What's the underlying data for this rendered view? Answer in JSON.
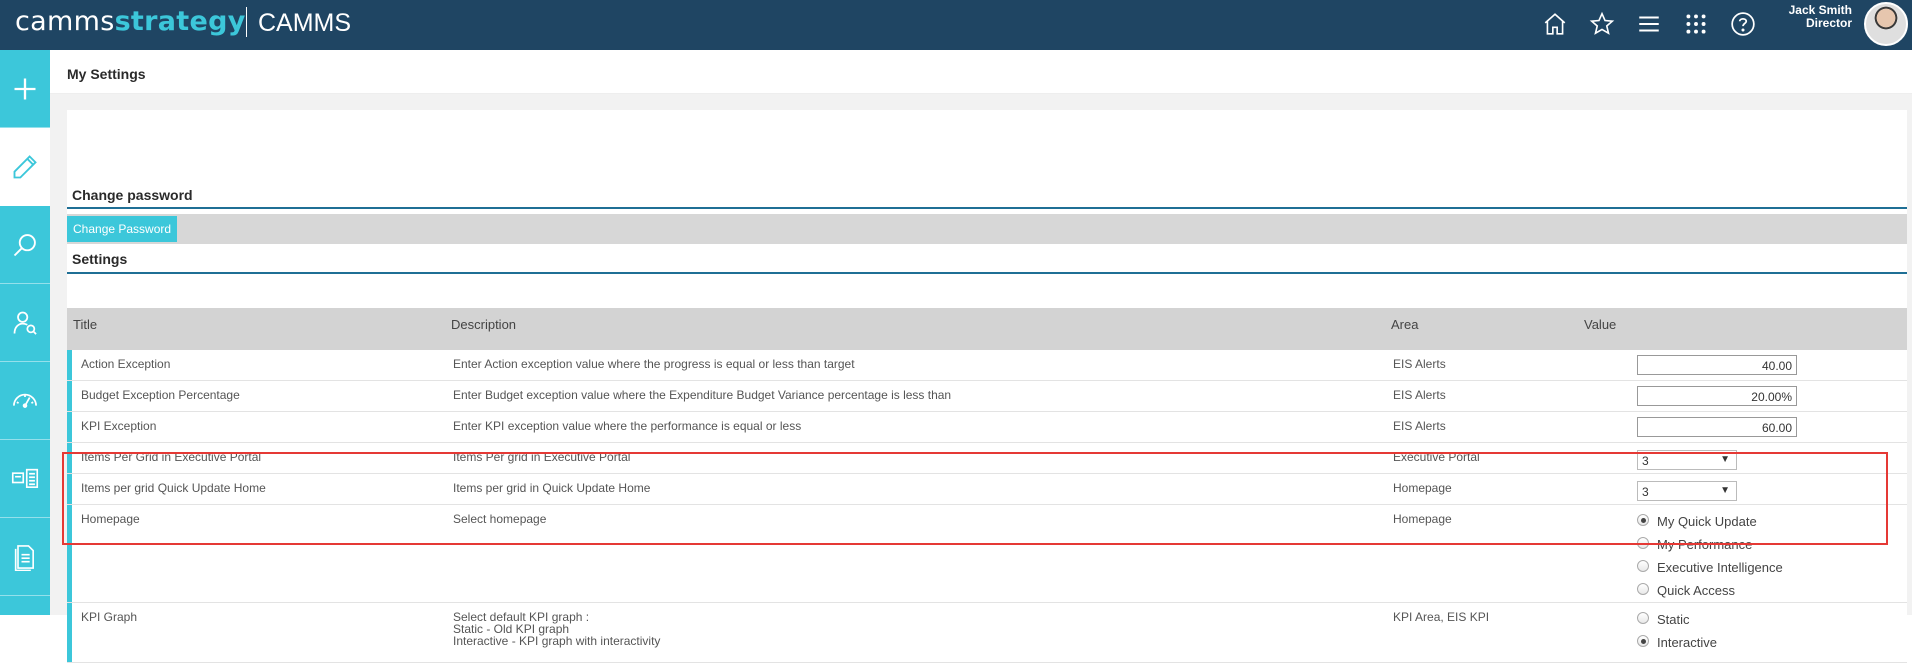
{
  "header": {
    "logo_plain": "camms",
    "logo_accent": "strategy",
    "org": "CAMMS",
    "user_name": "Jack Smith",
    "user_role": "Director"
  },
  "icons": [
    "home-icon",
    "star-icon",
    "menu-icon",
    "apps-icon",
    "help-icon",
    "plus-icon",
    "pencil-icon",
    "search-icon",
    "user-search-icon",
    "gauge-icon",
    "cards-icon",
    "document-icon",
    "save-icon"
  ],
  "colors": {
    "topbar": "#1f4563",
    "accent": "#3cc7da",
    "highlight": "#e53935"
  },
  "page": {
    "title": "My Settings"
  },
  "change_password": {
    "title": "Change password",
    "button": "Change Password"
  },
  "settings": {
    "title": "Settings",
    "columns": {
      "title": "Title",
      "description": "Description",
      "area": "Area",
      "value": "Value"
    },
    "rows": [
      {
        "title": "Action Exception",
        "description": "Enter Action exception value where the progress is equal or less than target",
        "area": "EIS Alerts",
        "value": "40.00"
      },
      {
        "title": "Budget Exception Percentage",
        "description": "Enter Budget exception value where the Expenditure Budget Variance percentage is less than",
        "area": "EIS Alerts",
        "value": "20.00%"
      },
      {
        "title": "KPI Exception",
        "description": "Enter KPI exception value where the performance is equal or less",
        "area": "EIS Alerts",
        "value": "60.00"
      },
      {
        "title": "Items Per Grid in Executive Portal",
        "description": "Items Per grid in Executive Portal",
        "area": "Executive Portal",
        "value": "3"
      },
      {
        "title": "Items per grid Quick Update Home",
        "description": "Items per grid in Quick Update Home",
        "area": "Homepage",
        "value": "3"
      },
      {
        "title": "Homepage",
        "description": "Select homepage",
        "area": "Homepage",
        "options": [
          "My Quick Update",
          "My Performance",
          "Executive Intelligence",
          "Quick Access"
        ],
        "selected": "My Quick Update"
      },
      {
        "title": "KPI Graph",
        "description_lines": [
          "Select default KPI graph :",
          "Static - Old KPI graph",
          "Interactive - KPI graph with interactivity"
        ],
        "area": "KPI Area, EIS KPI",
        "options": [
          "Static",
          "Interactive"
        ],
        "selected": "Interactive"
      }
    ]
  }
}
